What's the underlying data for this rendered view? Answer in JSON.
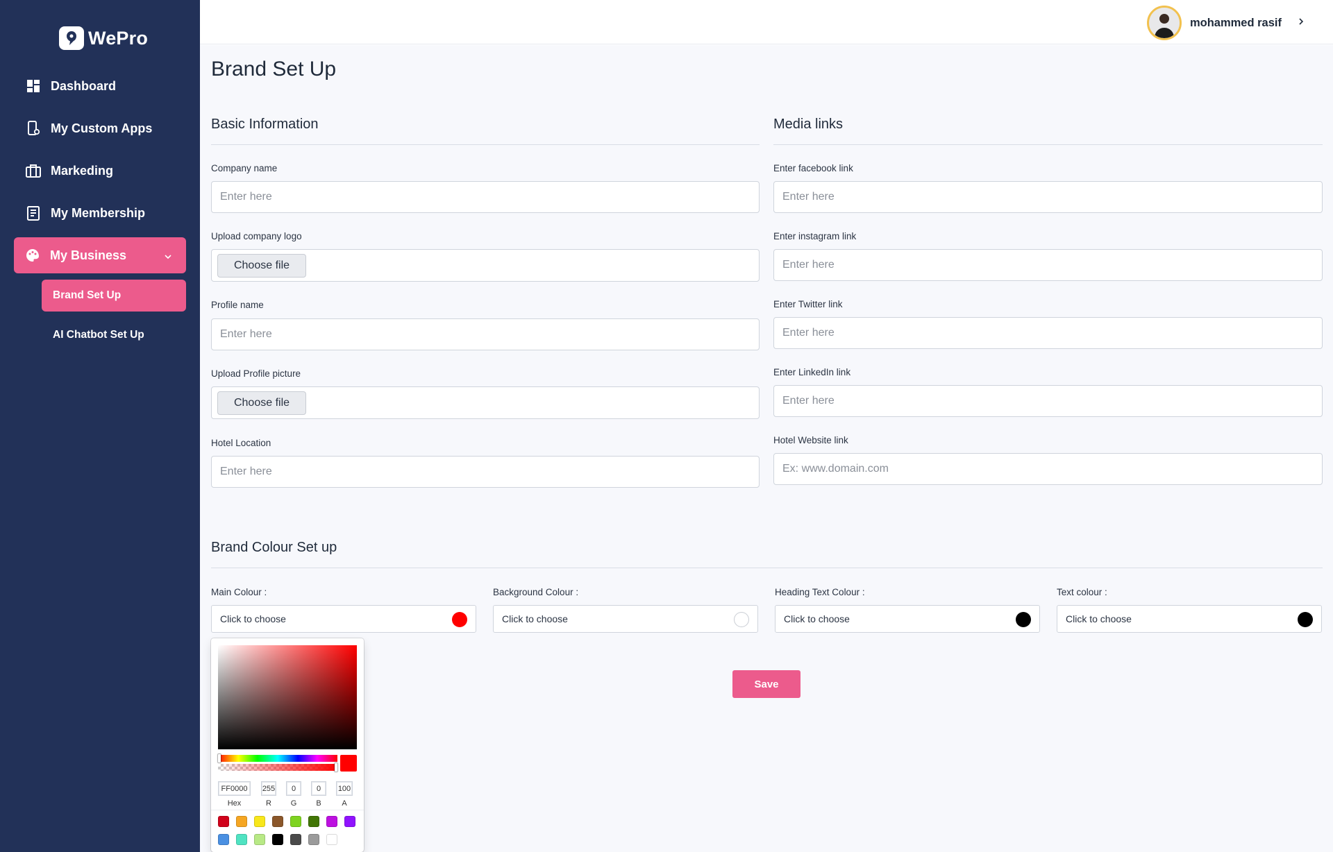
{
  "brand": {
    "name": "WePro"
  },
  "sidebar": {
    "items": [
      {
        "label": "Dashboard",
        "icon": "dashboard-grid-icon"
      },
      {
        "label": "My Custom Apps",
        "icon": "phone-settings-icon"
      },
      {
        "label": "Markeding",
        "icon": "briefcase-icon"
      },
      {
        "label": "My Membership",
        "icon": "document-icon"
      },
      {
        "label": "My Business",
        "icon": "palette-icon",
        "expanded": true
      }
    ],
    "sub_items": [
      {
        "label": "Brand Set Up",
        "active": true
      },
      {
        "label": "AI Chatbot Set Up",
        "active": false
      }
    ]
  },
  "header": {
    "user_name": "mohammed rasif"
  },
  "page": {
    "title": "Brand Set Up"
  },
  "basic_info": {
    "title": "Basic Information",
    "company_name": {
      "label": "Company name",
      "placeholder": "Enter here"
    },
    "company_logo": {
      "label": "Upload company logo",
      "button": "Choose file"
    },
    "profile_name": {
      "label": "Profile name",
      "placeholder": "Enter here"
    },
    "profile_picture": {
      "label": "Upload Profile picture",
      "button": "Choose file"
    },
    "hotel_location": {
      "label": "Hotel Location",
      "placeholder": "Enter here"
    }
  },
  "media_links": {
    "title": "Media links",
    "facebook": {
      "label": "Enter facebook link",
      "placeholder": "Enter here"
    },
    "instagram": {
      "label": "Enter instagram link",
      "placeholder": "Enter here"
    },
    "twitter": {
      "label": "Enter Twitter link",
      "placeholder": "Enter here"
    },
    "linkedin": {
      "label": "Enter LinkedIn link",
      "placeholder": "Enter here"
    },
    "website": {
      "label": "Hotel Website link",
      "placeholder": "Ex: www.domain.com"
    }
  },
  "brand_colour": {
    "title": "Brand Colour Set up",
    "fields": [
      {
        "label": "Main Colour :",
        "value": "Click to choose",
        "color": "#ff0000"
      },
      {
        "label": "Background Colour :",
        "value": "Click to choose",
        "color": "#ffffff"
      },
      {
        "label": "Heading Text Colour :",
        "value": "Click to choose",
        "color": "#000000"
      },
      {
        "label": "Text colour :",
        "value": "Click to choose",
        "color": "#000000"
      }
    ],
    "save_label": "Save"
  },
  "color_picker": {
    "hex": "FF0000",
    "r": "255",
    "g": "0",
    "b": "0",
    "a": "100",
    "hex_label": "Hex",
    "r_label": "R",
    "g_label": "G",
    "b_label": "B",
    "a_label": "A",
    "current": "#ff0000",
    "presets": [
      "#d0021b",
      "#f5a623",
      "#f8e71c",
      "#8b572a",
      "#7ed321",
      "#417505",
      "#bd10e0",
      "#9013fe",
      "#4a90e2",
      "#50e3c2",
      "#b8e986",
      "#000000",
      "#4a4a4a",
      "#9b9b9b",
      "#ffffff"
    ]
  }
}
